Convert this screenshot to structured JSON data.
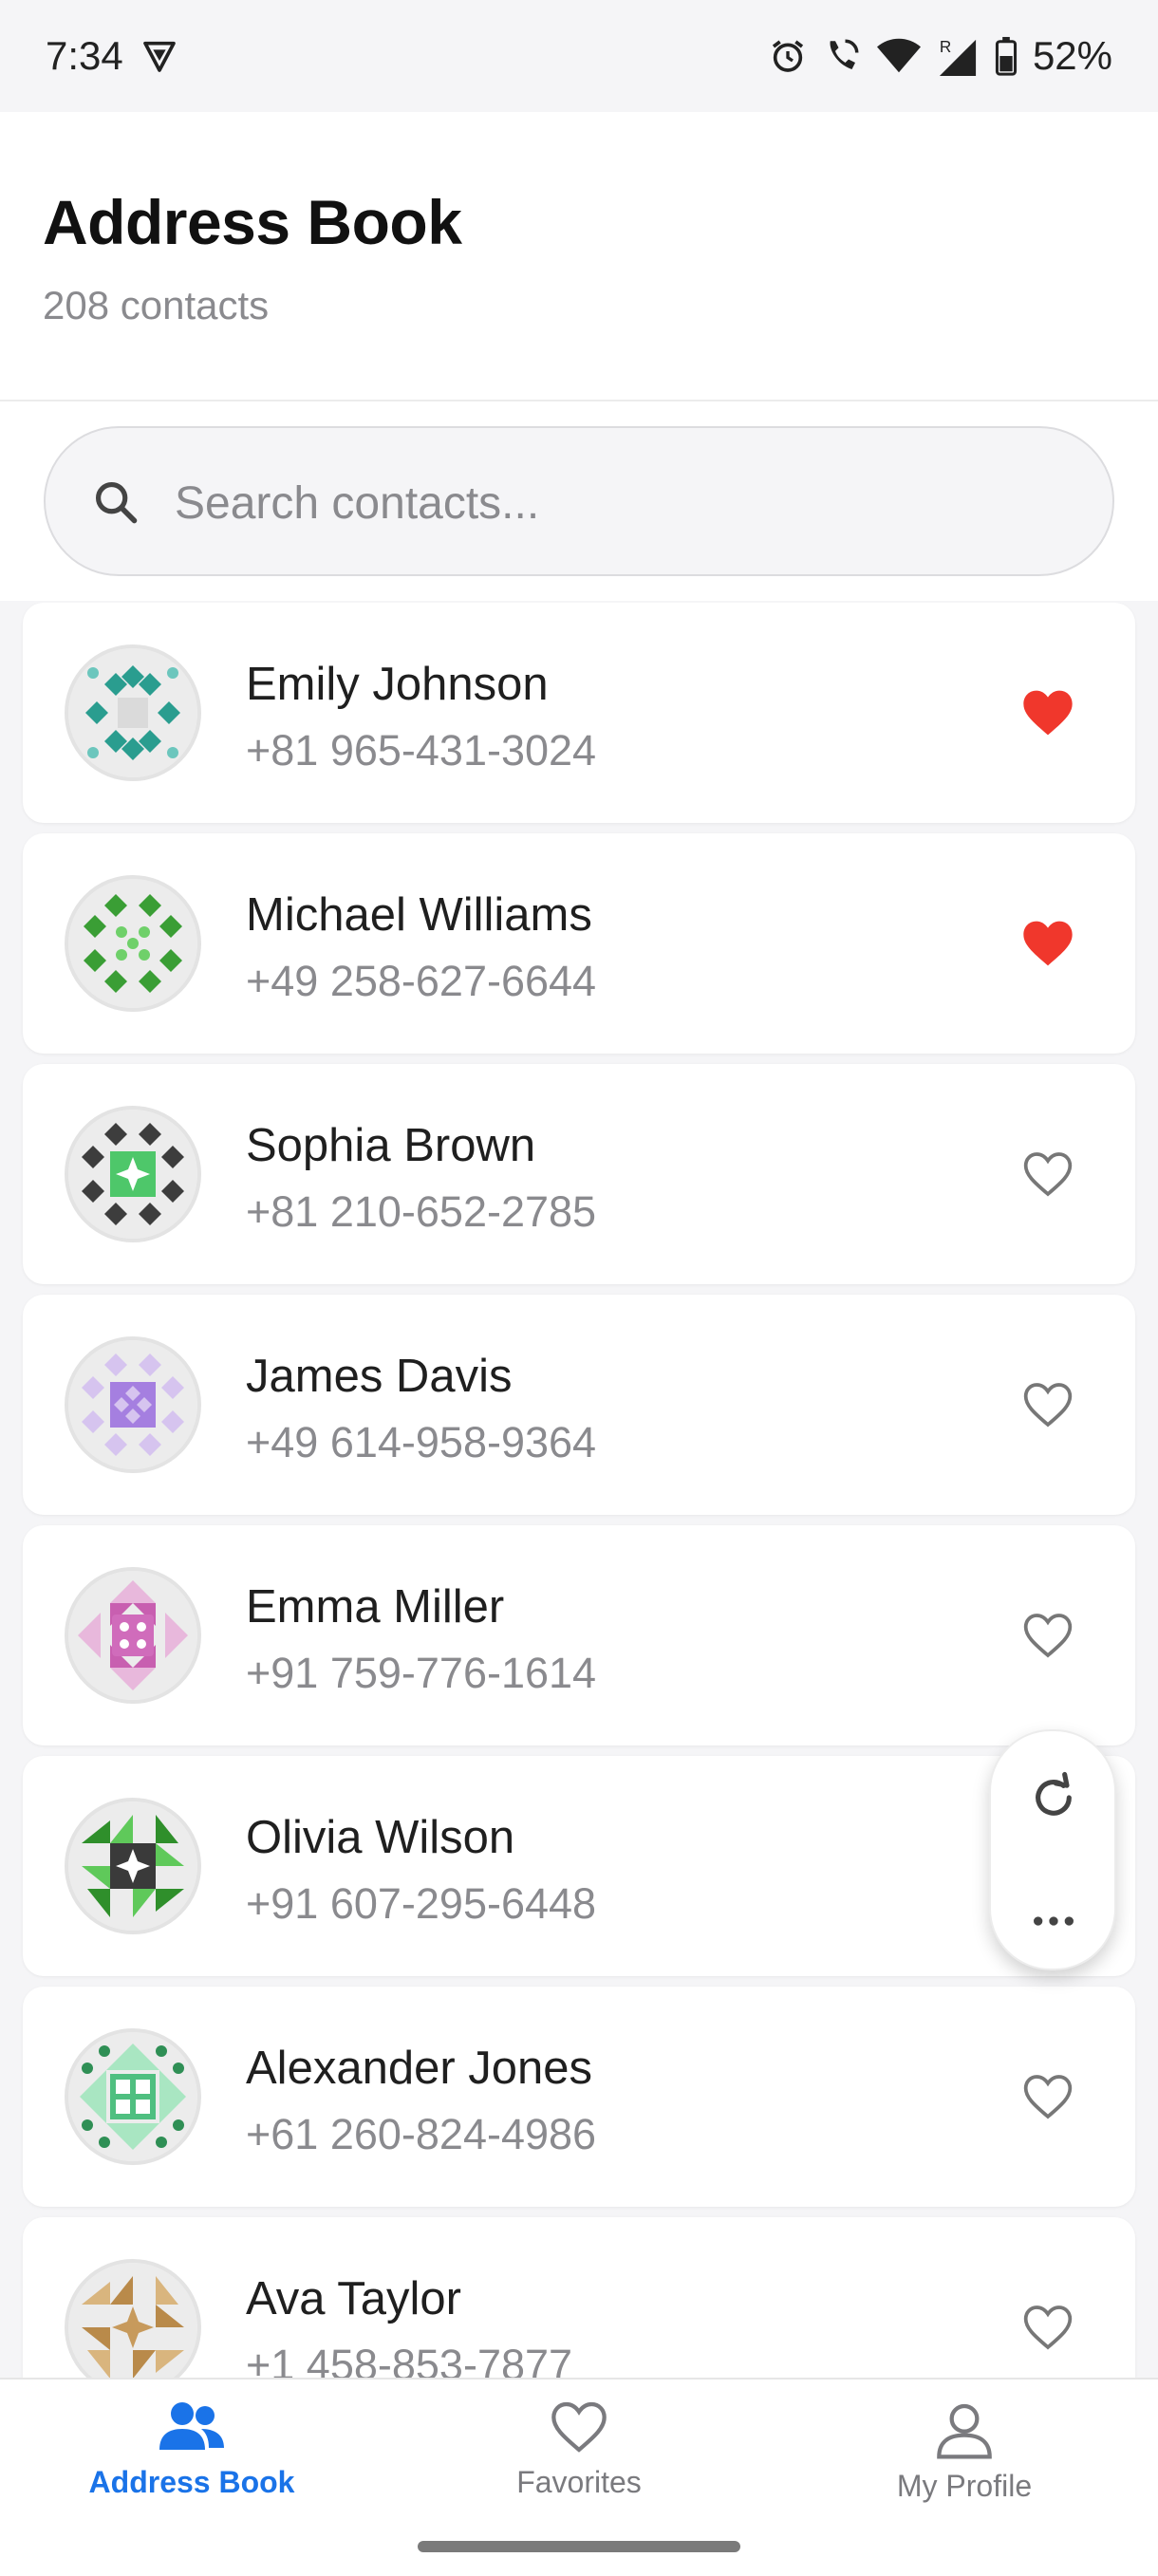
{
  "status_bar": {
    "time": "7:34",
    "battery": "52%"
  },
  "header": {
    "title": "Address Book",
    "subtitle": "208 contacts"
  },
  "search": {
    "placeholder": "Search contacts..."
  },
  "contacts": [
    {
      "name": "Emily Johnson",
      "phone": "+81 965-431-3024",
      "favorite": true,
      "avatar_color": "#2a9d8f"
    },
    {
      "name": "Michael Williams",
      "phone": "+49 258-627-6644",
      "favorite": true,
      "avatar_color": "#3fa33a"
    },
    {
      "name": "Sophia Brown",
      "phone": "+81 210-652-2785",
      "favorite": false,
      "avatar_color": "#3d3d3d"
    },
    {
      "name": "James Davis",
      "phone": "+49 614-958-9364",
      "favorite": false,
      "avatar_color": "#8e5bd6"
    },
    {
      "name": "Emma Miller",
      "phone": "+91 759-776-1614",
      "favorite": false,
      "avatar_color": "#c85fb0"
    },
    {
      "name": "Olivia Wilson",
      "phone": "+91 607-295-6448",
      "favorite": false,
      "avatar_color": "#5fc95a"
    },
    {
      "name": "Alexander Jones",
      "phone": "+61 260-824-4986",
      "favorite": false,
      "avatar_color": "#41b57a"
    },
    {
      "name": "Ava Taylor",
      "phone": "+1 458-853-7877",
      "favorite": false,
      "avatar_color": "#b98a4a"
    }
  ],
  "fab": {
    "icons": [
      "refresh-icon",
      "more-icon"
    ]
  },
  "bottom_nav": [
    {
      "label": "Address Book",
      "icon": "people-icon",
      "active": true
    },
    {
      "label": "Favorites",
      "icon": "heart-outline-icon",
      "active": false
    },
    {
      "label": "My Profile",
      "icon": "person-icon",
      "active": false
    }
  ],
  "colors": {
    "accent": "#1a73e8",
    "favorite": "#f0372c",
    "muted": "#8a8a8e"
  }
}
